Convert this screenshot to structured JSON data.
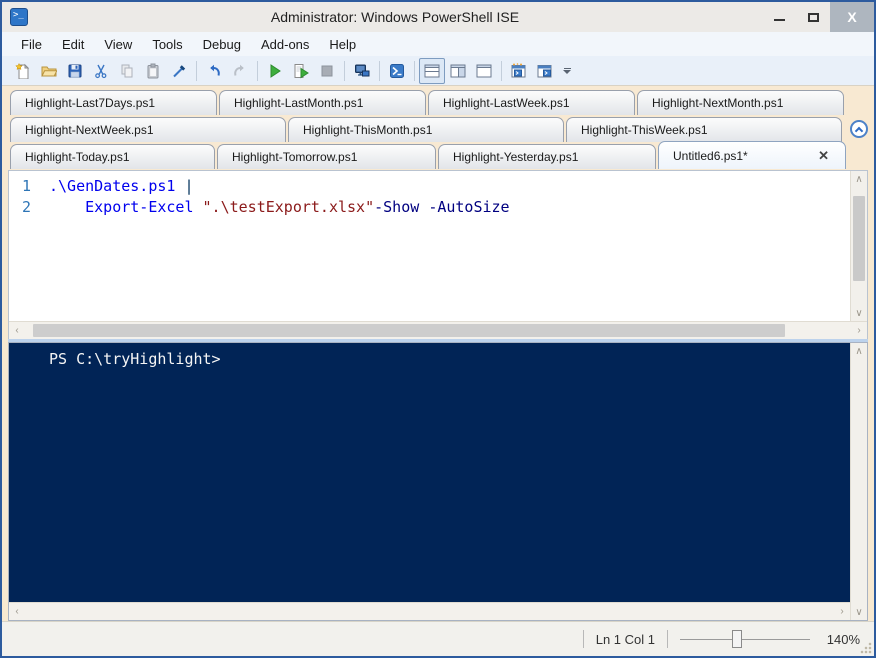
{
  "window": {
    "title": "Administrator: Windows PowerShell ISE"
  },
  "titlebar": {
    "minimize_glyph": "",
    "maximize_glyph": "",
    "close_glyph": "X"
  },
  "menu": {
    "items": [
      "File",
      "Edit",
      "View",
      "Tools",
      "Debug",
      "Add-ons",
      "Help"
    ]
  },
  "toolbar": {
    "buttons": [
      "new-script",
      "open-script",
      "save-script",
      "cut",
      "copy",
      "paste",
      "clear-console-pane",
      "undo",
      "redo",
      "run-script",
      "run-selection",
      "stop-operation",
      "new-remote-powershell-tab",
      "start-powershell-exe",
      "show-script-pane-top",
      "show-script-pane-right",
      "show-script-pane-maximized",
      "new-powershell-tab",
      "close-powershell-tab"
    ],
    "selected_button": "show-script-pane-top",
    "disabled_buttons": [
      "copy",
      "redo",
      "stop-operation"
    ]
  },
  "tabs": {
    "rows": [
      [
        {
          "label": "Highlight-Last7Days.ps1"
        },
        {
          "label": "Highlight-LastMonth.ps1"
        },
        {
          "label": "Highlight-LastWeek.ps1"
        },
        {
          "label": "Highlight-NextMonth.ps1"
        }
      ],
      [
        {
          "label": "Highlight-NextWeek.ps1"
        },
        {
          "label": "Highlight-ThisMonth.ps1"
        },
        {
          "label": "Highlight-ThisWeek.ps1"
        }
      ],
      [
        {
          "label": "Highlight-Today.ps1"
        },
        {
          "label": "Highlight-Tomorrow.ps1"
        },
        {
          "label": "Highlight-Yesterday.ps1"
        },
        {
          "label": "Untitled6.ps1*"
        }
      ]
    ],
    "active_tab": "Untitled6.ps1*",
    "close_glyph": "✕"
  },
  "editor": {
    "lines": [
      {
        "number": "1",
        "tokens": [
          {
            "t": ".\\GenDates.ps1 ",
            "c": "blue"
          },
          {
            "t": "|",
            "c": "op"
          }
        ]
      },
      {
        "number": "2",
        "tokens": [
          {
            "t": "    ",
            "c": "plain"
          },
          {
            "t": "Export-Excel",
            "c": "blue"
          },
          {
            "t": " ",
            "c": "plain"
          },
          {
            "t": "\".\\testExport.xlsx\"",
            "c": "string"
          },
          {
            "t": "-Show",
            "c": "param"
          },
          {
            "t": " ",
            "c": "plain"
          },
          {
            "t": "-AutoSize",
            "c": "param"
          }
        ]
      }
    ]
  },
  "console": {
    "prompt": "PS C:\\tryHighlight>"
  },
  "statusbar": {
    "position": "Ln 1 Col 1",
    "zoom_percent": "140%",
    "zoom_slider_fraction": 0.4
  },
  "scroll_glyphs": {
    "up": "∧",
    "down": "∨",
    "left": "‹",
    "right": "›"
  },
  "colors": {
    "window_border": "#2d5b9e",
    "chrome_cream": "#f8e9d2",
    "toolbar_bg": "#e9f0f9",
    "console_bg": "#012456",
    "console_text": "#f5f5f5",
    "line_number": "#2e75b6",
    "token_command": "#0000ee",
    "token_string": "#8b1a1a",
    "token_parameter": "#000080",
    "token_operator": "#01325c",
    "run_green": "#3dae3d",
    "powershell_blue": "#2e76c8"
  }
}
